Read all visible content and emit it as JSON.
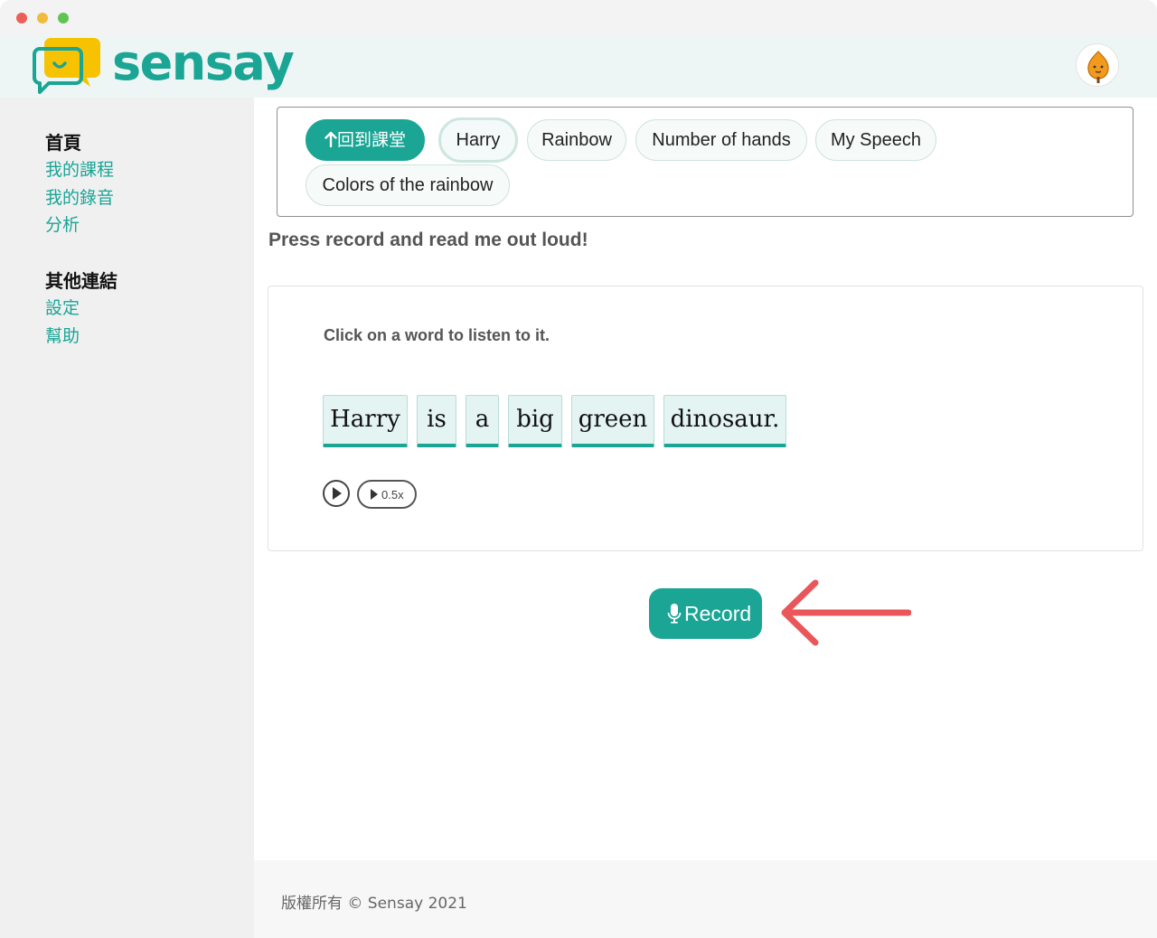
{
  "brand": {
    "name": "sensay",
    "color": "#1aa595"
  },
  "user": {
    "avatar_icon": "sweet-potato-avatar-icon"
  },
  "sidebar": {
    "sections": [
      {
        "heading": "首頁",
        "links": [
          "我的課程",
          "我的錄音",
          "分析"
        ]
      },
      {
        "heading": "其他連結",
        "links": [
          "設定",
          "幫助"
        ]
      }
    ]
  },
  "lesson_nav": {
    "back_label": "回到課堂",
    "back_icon": "arrow-up-icon",
    "items": [
      "Harry",
      "Rainbow",
      "Number of hands",
      "My Speech",
      "Colors of the rainbow"
    ],
    "active": "Harry"
  },
  "main": {
    "prompt": "Press record and read me out loud!",
    "hint": "Click on a word to listen to it.",
    "words": [
      "Harry",
      "is",
      "a",
      "big",
      "green",
      "dinosaur."
    ],
    "playback": {
      "play_icon": "play-icon",
      "slow_label": "0.5x"
    },
    "record_label": "Record",
    "record_icon": "microphone-icon",
    "annotation_color": "#e9575a"
  },
  "footer": {
    "text": "版權所有 © Sensay 2021"
  }
}
